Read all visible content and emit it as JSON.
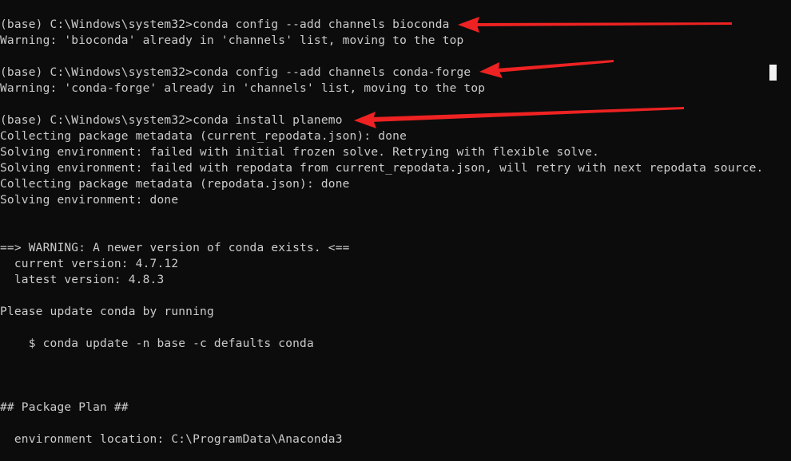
{
  "terminal": {
    "background": "#0c0c0c",
    "text_color": "#cccccc",
    "lines": [
      "(base) C:\\Windows\\system32>conda config --add channels bioconda",
      "Warning: 'bioconda' already in 'channels' list, moving to the top",
      "",
      "(base) C:\\Windows\\system32>conda config --add channels conda-forge",
      "Warning: 'conda-forge' already in 'channels' list, moving to the top",
      "",
      "(base) C:\\Windows\\system32>conda install planemo",
      "Collecting package metadata (current_repodata.json): done",
      "Solving environment: failed with initial frozen solve. Retrying with flexible solve.",
      "Solving environment: failed with repodata from current_repodata.json, will retry with next repodata source.",
      "Collecting package metadata (repodata.json): done",
      "Solving environment: done",
      "",
      "",
      "==> WARNING: A newer version of conda exists. <==",
      "  current version: 4.7.12",
      "  latest version: 4.8.3",
      "",
      "Please update conda by running",
      "",
      "    $ conda update -n base -c defaults conda",
      "",
      "",
      "",
      "## Package Plan ##",
      "",
      "  environment location: C:\\ProgramData\\Anaconda3"
    ]
  },
  "annotations": {
    "arrow_color": "#ee2222",
    "arrows": [
      {
        "name": "arrow-bioconda",
        "target_line": 0
      },
      {
        "name": "arrow-conda-forge",
        "target_line": 3
      },
      {
        "name": "arrow-planemo",
        "target_line": 6
      }
    ]
  }
}
